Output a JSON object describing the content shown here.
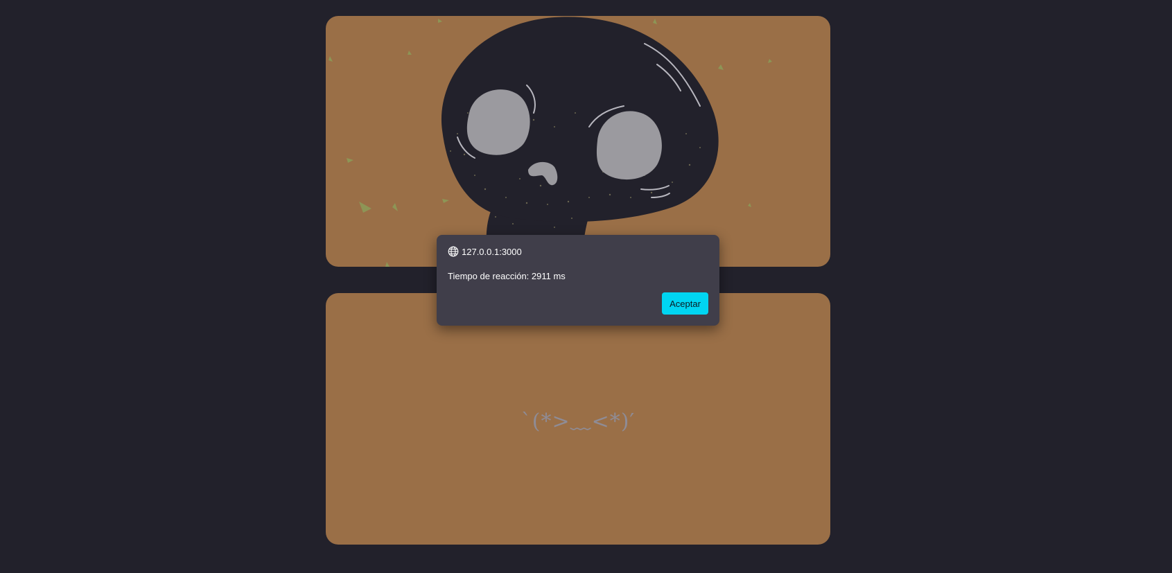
{
  "dialog": {
    "origin": "127.0.0.1:3000",
    "origin_icon": "globe-icon",
    "message": "Tiempo de reacción: 2911 ms",
    "ok_label": "Aceptar"
  },
  "bottom_card": {
    "kaomoji": "`(*>﹏<*)′"
  },
  "colors": {
    "background": "#22212b",
    "card": "#9a6f47",
    "dialog": "#403e4a",
    "accent": "#00d5f2"
  }
}
